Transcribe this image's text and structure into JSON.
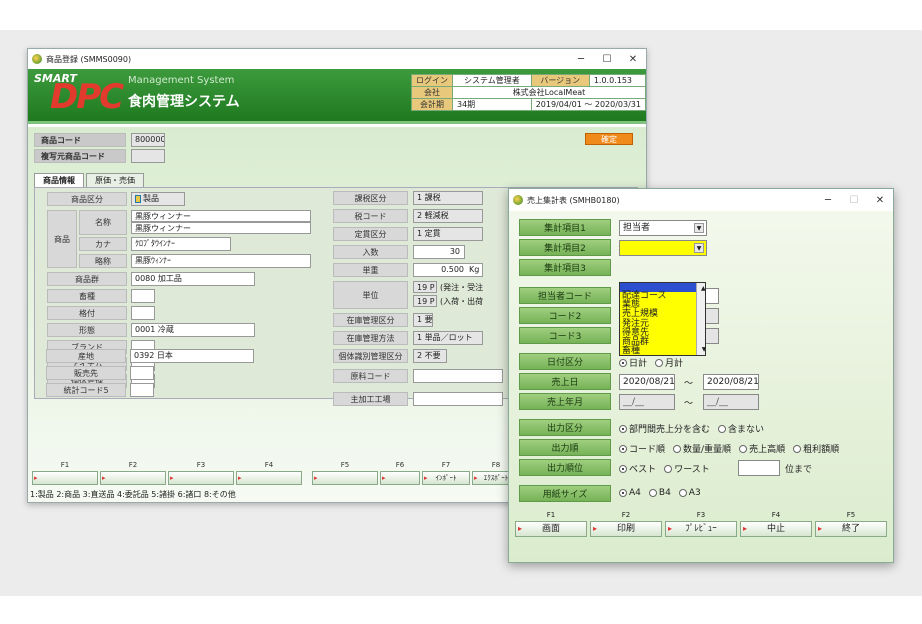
{
  "win1": {
    "title": "商品登録 (SMMS0090)",
    "banner": {
      "brand_smart": "SMART",
      "brand_dpc": "DPC",
      "subtitle": "Management System",
      "title": "食肉管理システム"
    },
    "info": {
      "login_label": "ログイン",
      "login_value": "システム管理者",
      "version_label": "バージョン",
      "version_value": "1.0.0.153",
      "company_label": "会社",
      "company_value": "株式会社LocalMeat",
      "period_label": "会計期",
      "period_num": "34期",
      "period_range": "2019/04/01 ～ 2020/03/31"
    },
    "code_label": "商品コード",
    "code_value": "800000",
    "copy_label": "複写元商品コード",
    "kakutei": "確定",
    "tabs": [
      "商品情報",
      "原価・売価"
    ],
    "left": {
      "kubun_label": "商品区分",
      "kubun_value": "製品",
      "shohin_label": "商品",
      "name_label": "名称",
      "name_value1": "黒豚ウィンナー",
      "name_value2": "黒豚ウィンナー",
      "kana_label": "カナ",
      "kana_value": "ｸﾛﾌﾞﾀｳｲﾝﾅｰ",
      "short_label": "略称",
      "short_value": "黒豚ｳｨﾝﾅｰ",
      "group_label": "商品群",
      "group_value": "0080 加工品",
      "kind_label": "畜種",
      "cut_label": "格付",
      "state_label": "形態",
      "state_value": "0001 冷蔵",
      "brand_label": "ブランド",
      "item_label": "アイテム",
      "ind_label": "個体管理",
      "origin_label": "産地",
      "origin_value": "0392 日本",
      "seller_label": "販売先",
      "stat_label": "統計コード5"
    },
    "right": {
      "tax_label": "課税区分",
      "tax_value": "1 課税",
      "taxcode_label": "税コード",
      "taxcode_value": "2 軽減税",
      "price_label": "定貫区分",
      "price_value": "1 定貫",
      "qty_label": "入数",
      "qty_value": "30",
      "weight_label": "単重",
      "weight_value": "0.500",
      "weight_unit": "Kg",
      "unit_label": "単位",
      "unit_value1": "19 P",
      "unit_value2": "19 P",
      "unit_note1": "(発注・受注",
      "unit_note2": "(入荷・出荷",
      "stock_label": "在庫管理区分",
      "stock_value": "1 要",
      "stockm_label": "在庫管理方法",
      "stockm_value": "1 単品／ロット",
      "indiv_label": "個体識別管理区分",
      "indiv_value": "2 不要",
      "raw_label": "原料コード",
      "factory_label": "主加工工場"
    },
    "fkeys": [
      {
        "n": "F1",
        "b": ""
      },
      {
        "n": "F2",
        "b": ""
      },
      {
        "n": "F3",
        "b": ""
      },
      {
        "n": "F4",
        "b": ""
      },
      {
        "n": "F5",
        "b": ""
      },
      {
        "n": "F6",
        "b": ""
      },
      {
        "n": "F7",
        "b": "ｲﾝﾎﾟｰﾄ"
      },
      {
        "n": "F8",
        "b": "ｴｸｽﾎﾟｰﾄ"
      },
      {
        "n": "F9",
        "b": ""
      }
    ],
    "status": "1:製品 2:商品 3:直送品 4:委託品 5:諸掛 6:諸口 8:その他"
  },
  "win2": {
    "title": "売上集計表 (SMHB0180)",
    "item1_label": "集計項目1",
    "item1_value": "担当者",
    "item2_label": "集計項目2",
    "item3_label": "集計項目3",
    "dropdown": [
      "",
      "配達コース",
      "業態",
      "売上規模",
      "発注元",
      "得意先",
      "商品群",
      "畜種"
    ],
    "tanto_label": "担当者コード",
    "code2_label": "コード2",
    "code3_label": "コード3",
    "date_kubun_label": "日付区分",
    "date_opt1": "日計",
    "date_opt2": "月計",
    "uriagebi_label": "売上日",
    "date_from": "2020/08/21",
    "tilde": "～",
    "date_to": "2020/08/21",
    "uriage_ym_label": "売上年月",
    "ym_from": "__/__",
    "ym_to": "__/__",
    "output_kubun_label": "出力区分",
    "out_opt1": "部門間売上分を含む",
    "out_opt2": "含まない",
    "order_label": "出力順",
    "order_opts": [
      "コード順",
      "数量/重量順",
      "売上高順",
      "粗利額順"
    ],
    "rank_label": "出力順位",
    "rank_opt1": "ベスト",
    "rank_opt2": "ワースト",
    "rank_suffix": "位まで",
    "paper_label": "用紙サイズ",
    "paper_opts": [
      "A4",
      "B4",
      "A3"
    ],
    "fkeys": [
      {
        "n": "F1",
        "b": "画面"
      },
      {
        "n": "F2",
        "b": "印刷"
      },
      {
        "n": "F3",
        "b": "ﾌﾟﾚﾋﾞｭｰ"
      },
      {
        "n": "F4",
        "b": "中止"
      },
      {
        "n": "F5",
        "b": "終了"
      }
    ]
  }
}
